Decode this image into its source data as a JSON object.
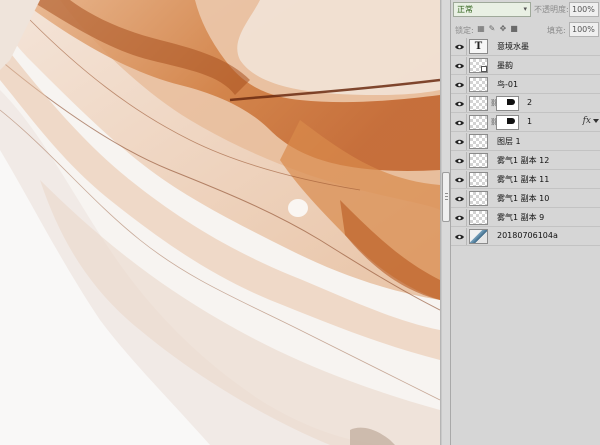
{
  "canvas": {
    "description_colors": {
      "paper": "#f7f4f1",
      "ink_dark": "#b8581f",
      "ink_mid": "#d9905a",
      "ink_light": "#efd3bd",
      "ink_grey": "#cdbcb1"
    }
  },
  "layers_panel": {
    "blend_mode": "正常",
    "opacity_label": "不透明度:",
    "opacity_value": "100%",
    "lock_label": "锁定:",
    "fill_label": "填充:",
    "fill_value": "100%",
    "layers": [
      {
        "name": "意境水墨",
        "type": "text",
        "thumb_glyph": "T"
      },
      {
        "name": "墨韵",
        "type": "smart"
      },
      {
        "name": "鸟-01",
        "type": "pixel"
      },
      {
        "name": "2",
        "type": "masked"
      },
      {
        "name": "1",
        "type": "masked",
        "fx": "fx"
      },
      {
        "name": "图层 1",
        "type": "pixel"
      },
      {
        "name": "雾气1 副本 12",
        "type": "pixel"
      },
      {
        "name": "雾气1 副本 11",
        "type": "pixel"
      },
      {
        "name": "雾气1 副本 10",
        "type": "pixel"
      },
      {
        "name": "雾气1 副本 9",
        "type": "pixel"
      },
      {
        "name": "20180706104a",
        "type": "photo"
      }
    ],
    "icons": {
      "eye": "eye-icon",
      "link": "link-icon",
      "lock_items": [
        "lock-transparent-icon",
        "lock-brush-icon",
        "lock-move-icon",
        "lock-all-icon"
      ]
    }
  }
}
